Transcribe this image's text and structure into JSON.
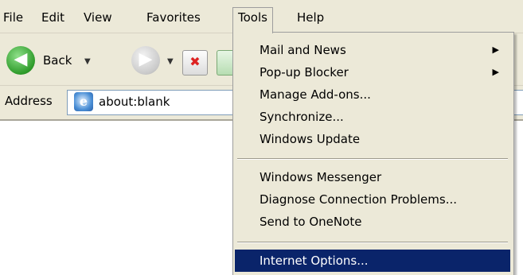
{
  "menubar": {
    "items": [
      {
        "label": "File"
      },
      {
        "label": "Edit"
      },
      {
        "label": "View"
      },
      {
        "label": "Favorites"
      },
      {
        "label": "Tools"
      },
      {
        "label": "Help"
      }
    ]
  },
  "toolbar": {
    "back_label": "Back",
    "back_icon": "back-arrow-icon",
    "forward_icon": "forward-arrow-icon",
    "stop_icon": "stop-icon",
    "refresh_icon": "refresh-icon"
  },
  "address": {
    "label": "Address",
    "value": "about:blank",
    "page_icon": "ie-page-icon"
  },
  "tools_menu": {
    "groups": [
      [
        {
          "label": "Mail and News",
          "submenu": true
        },
        {
          "label": "Pop-up Blocker",
          "submenu": true
        },
        {
          "label": "Manage Add-ons...",
          "submenu": false
        },
        {
          "label": "Synchronize...",
          "submenu": false
        },
        {
          "label": "Windows Update",
          "submenu": false
        }
      ],
      [
        {
          "label": "Windows Messenger",
          "submenu": false
        },
        {
          "label": "Diagnose Connection Problems...",
          "submenu": false
        },
        {
          "label": "Send to OneNote",
          "submenu": false
        }
      ],
      [
        {
          "label": "Internet Options...",
          "submenu": false,
          "highlighted": true
        }
      ]
    ],
    "highlight_color": "#0a246a"
  },
  "colors": {
    "chrome": "#ece9d8",
    "highlight": "#0a246a"
  }
}
